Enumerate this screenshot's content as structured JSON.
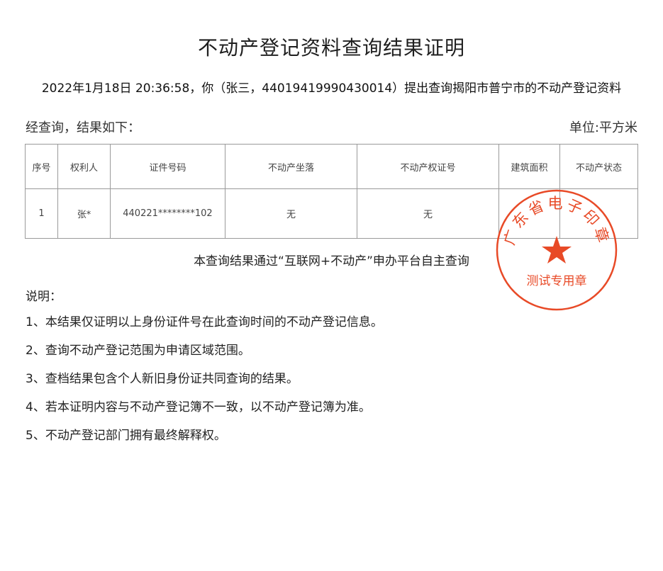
{
  "document": {
    "title": "不动产登记资料查询结果证明",
    "query_info": "2022年1月18日 20:36:58，你（张三，44019419990430014）提出查询揭阳市普宁市的不动产登记资料",
    "result_intro": "经查询，结果如下：",
    "unit": "单位:平方米",
    "platform_note": "本查询结果通过“互联网+不动产”申办平台自主查询"
  },
  "table": {
    "headers": [
      "序号",
      "权利人",
      "证件号码",
      "不动产坐落",
      "不动产权证号",
      "建筑面积",
      "不动产状态"
    ],
    "rows": [
      [
        "1",
        "张*",
        "440221********102",
        "无",
        "无",
        "",
        ""
      ]
    ]
  },
  "notes": {
    "heading": "说明：",
    "items": [
      "1、本结果仅证明以上身份证件号在此查询时间的不动产登记信息。",
      "2、查询不动产登记范围为申请区域范围。",
      "3、查档结果包含个人新旧身份证共同查询的结果。",
      "4、若本证明内容与不动产登记簿不一致，以不动产登记簿为准。",
      "5、不动产登记部门拥有最终解释权。"
    ]
  },
  "seal": {
    "top_text": "广东省电子印章",
    "bottom_text": "测试专用章",
    "color": "#e84a27",
    "icon": "star-icon"
  }
}
